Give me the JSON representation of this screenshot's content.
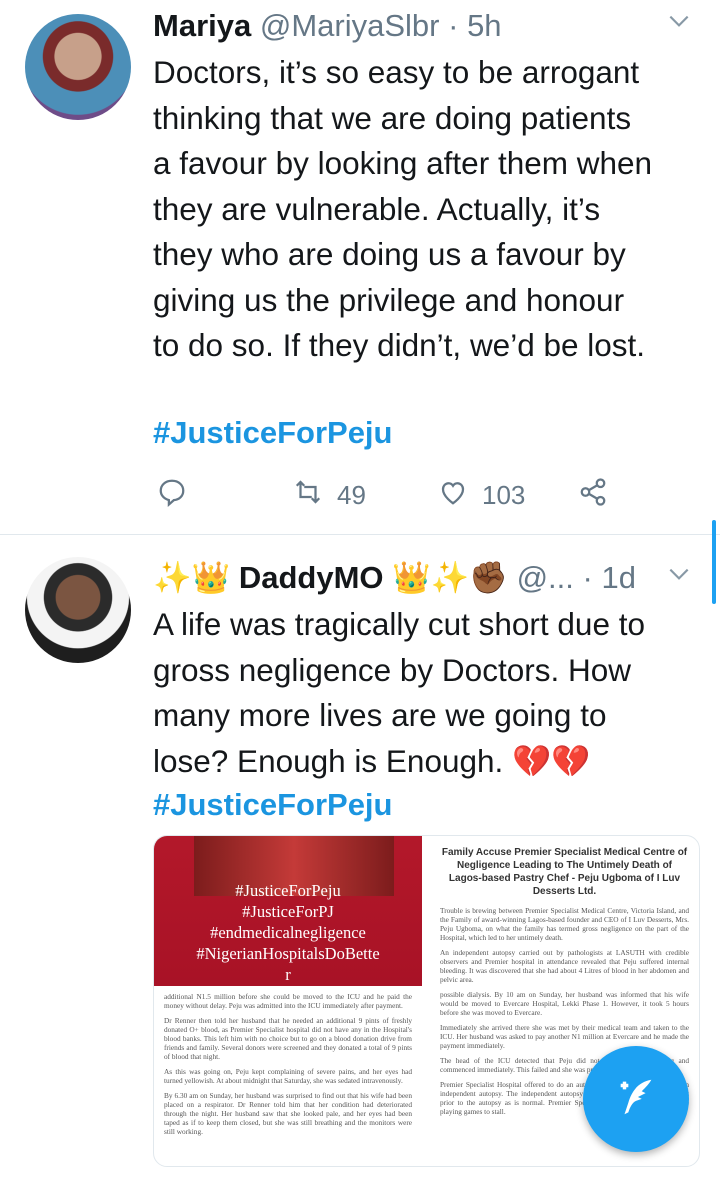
{
  "tweets": [
    {
      "name": "Mariya",
      "handle": "@MariyaSlbr",
      "separator": "·",
      "time": "5h",
      "lines": [
        "Doctors, it’s so easy to be arrogant",
        "thinking that we are doing patients",
        "a favour by looking after them when",
        "they  are vulnerable. Actually, it’s",
        "they who are doing us a favour by",
        "giving us the privilege and honour",
        "to do so. If they didn’t, we’d be lost."
      ],
      "hashtag": "#JusticeForPeju",
      "retweets": "49",
      "likes": "103"
    },
    {
      "name_prefix": "✨👑",
      "name": "DaddyMO",
      "name_suffix": "👑✨✊🏾",
      "handle": "@...",
      "separator": "·",
      "time": "1d",
      "lines": [
        "A life was tragically cut short due to",
        "gross negligence by Doctors. How",
        "many more lives are we going to",
        "lose? Enough is Enough. 💔💔"
      ],
      "hashtag": "#JusticeForPeju"
    }
  ],
  "card": {
    "image_tags": [
      "#JusticeForPeju",
      "#JusticeForPJ",
      "#endmedicalnegligence",
      "#NigerianHospitalsDoBette",
      "r"
    ],
    "doc_title": "Family Accuse Premier Specialist Medical Centre of Negligence Leading to The Untimely Death of Lagos-based Pastry Chef - Peju Ugboma of I Luv Desserts Ltd.",
    "doc_right_paragraphs": [
      "Trouble is brewing between Premier Specialist Medical Centre, Victoria Island, and the Family of award-winning Lagos-based founder and CEO of I Luv Desserts, Mrs. Peju Ugboma, on what the family has termed gross negligence on the part of the Hospital, which led to her untimely death.",
      "An independent autopsy carried out by pathologists at LASUTH with credible observers and Premier hospital in attendance revealed that Peju suffered internal bleeding. It was discovered that she had about 4 Litres of blood in her abdomen and pelvic area.",
      "possible dialysis. By 10 am on Sunday, her husband was informed that his wife would be moved to Evercare Hospital, Lekki Phase 1. However, it took 5 hours before she was moved to Evercare.",
      "Immediately she arrived there she was met by their medical team and taken to the ICU. Her husband was asked to pay another N1 million at Evercare and he made the payment immediately.",
      "The head of the ICU detected that Peju did not have internal bleeding and commenced immediately. This failed and she was pronounced dead on Sunday.",
      "Premier Specialist Hospital offered to do an autopsy but the family insisted on an independent autopsy. The independent autopsy was done and the medical report prior to the autopsy as is normal. Premier Specialist Hospital management were playing games to stall."
    ],
    "doc_left_paragraphs": [
      "additional N1.5 million before she could be moved to the ICU and he paid the money without delay. Peju was admitted into the ICU immediately after payment.",
      "Dr Renner then told her husband that he needed an additional 9 pints of freshly donated O+ blood, as Premier Specialist hospital did not have any in the Hospital's blood banks. This left him with no choice but to go on a blood donation drive from friends and family. Several donors were screened and they donated a total of 9 pints of blood that night.",
      "As this was going on, Peju kept complaining of severe pains, and her eyes had turned yellowish. At about midnight that Saturday, she was sedated intravenously.",
      "By 6.30 am on Sunday, her husband was surprised to find out that his wife had been placed on a respirator. Dr Renner told him that her condition had deteriorated through the night. Her husband saw that she looked pale, and her eyes had been taped as if to keep them closed, but she was still breathing and the monitors were still working."
    ]
  },
  "colors": {
    "accent": "#1da1f2",
    "hashtag": "#1b95e0",
    "muted": "#657786",
    "image_red": "#b3182a"
  },
  "icons": [
    "chevron-down-icon",
    "reply-icon",
    "retweet-icon",
    "like-icon",
    "share-icon",
    "compose-tweet-icon"
  ]
}
